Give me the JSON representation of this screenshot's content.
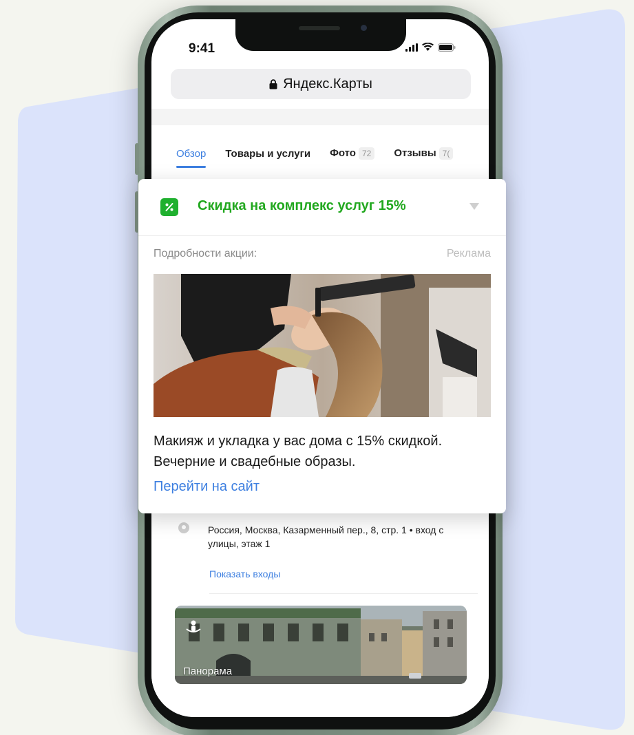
{
  "status_bar": {
    "time": "9:41"
  },
  "browser": {
    "address": "Яндекс.Карты"
  },
  "tabs": [
    {
      "label": "Обзор",
      "active": true
    },
    {
      "label": "Товары и услуги"
    },
    {
      "label": "Фото",
      "count": "72"
    },
    {
      "label": "Отзывы",
      "count": "7("
    }
  ],
  "ad": {
    "title": "Скидка на комплекс услуг 15%",
    "details_label": "Подробности акции:",
    "ad_marker": "Реклама",
    "description": "Макияж и укладка у вас дома с 15% скидкой. Вечерние и свадебные образы.",
    "link": "Перейти на сайт"
  },
  "place": {
    "address": "Россия, Москва, Казарменный пер., 8, стр. 1 • вход с улицы, этаж 1",
    "show_entrances": "Показать входы",
    "panorama_label": "Панорама"
  },
  "colors": {
    "accent_blue": "#3d7fe0",
    "discount_green": "#22a81f",
    "background_shape": "#dbe3fb"
  }
}
